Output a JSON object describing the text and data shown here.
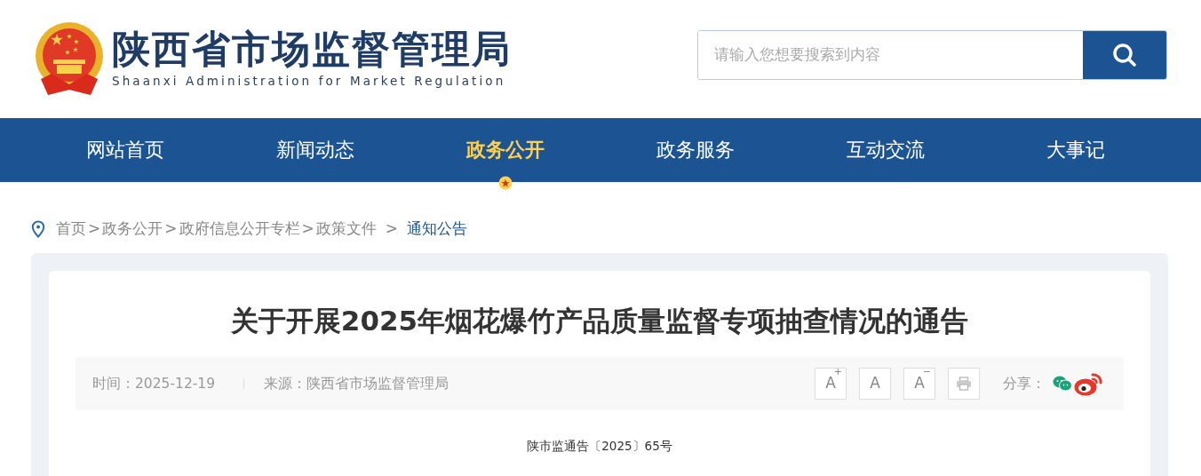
{
  "site": {
    "title": "陕西省市场监督管理局",
    "subtitle": "Shaanxi Administration for Market Regulation"
  },
  "search": {
    "placeholder": "请输入您想要搜索到内容"
  },
  "nav": [
    {
      "label": "网站首页",
      "selected": false
    },
    {
      "label": "新闻动态",
      "selected": false
    },
    {
      "label": "政务公开",
      "selected": true
    },
    {
      "label": "政务服务",
      "selected": false
    },
    {
      "label": "互动交流",
      "selected": false
    },
    {
      "label": "大事记",
      "selected": false
    }
  ],
  "breadcrumb": [
    {
      "label": "首页",
      "current": false
    },
    {
      "label": "政务公开",
      "current": false
    },
    {
      "label": "政府信息公开专栏",
      "current": false
    },
    {
      "label": "政策文件",
      "current": false
    },
    {
      "label": "通知公告",
      "current": true
    }
  ],
  "breadcrumb_separator": ">",
  "article": {
    "title": "关于开展2025年烟花爆竹产品质量监督专项抽查情况的通告",
    "time": "时间：2025-12-19",
    "source": "来源：陕西省市场监督管理局",
    "font_buttons": [
      {
        "label": "A",
        "mark": "+"
      },
      {
        "label": "A"
      },
      {
        "label": "A",
        "mark": "−"
      }
    ],
    "share_label": "分享：",
    "doc_number": "陕市监通告〔2025〕65号"
  }
}
